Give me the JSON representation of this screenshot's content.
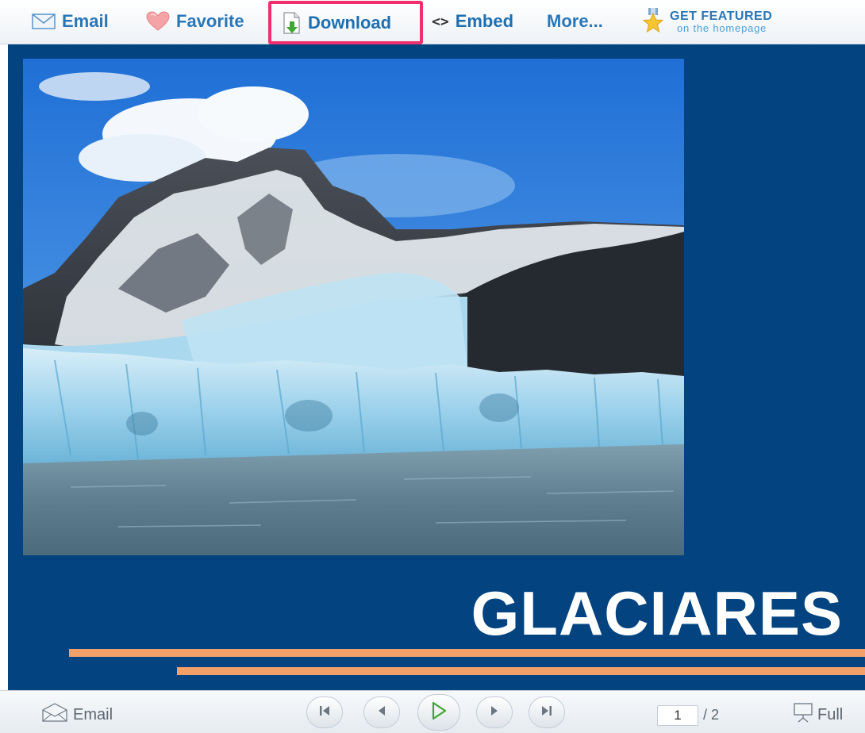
{
  "toolbar": {
    "email_label": "Email",
    "favorite_label": "Favorite",
    "download_label": "Download",
    "embed_glyph": "<>",
    "embed_label": "Embed",
    "more_label": "More...",
    "featured_title": "GET FEATURED",
    "featured_subtitle": "on the homepage",
    "highlight_color": "#f0306e",
    "link_color": "#2a77b8"
  },
  "slide": {
    "title": "GLACIARES",
    "background": "#024380",
    "stripe_color": "#f2a06a",
    "photo_subject": "glacier with snowy mountain peak, blue sky and lake"
  },
  "controls": {
    "email_label": "Email",
    "current_page": "1",
    "total_pages": "/ 2",
    "full_label": "Full",
    "buttons": [
      "first-slide",
      "previous-slide",
      "play",
      "next-slide",
      "last-slide"
    ]
  },
  "icons": {
    "toolbar": [
      "envelope-icon",
      "heart-icon",
      "download-icon",
      "star-badge-icon"
    ],
    "controls": [
      "envelope-open-icon",
      "skip-first-icon",
      "previous-icon",
      "play-icon",
      "next-icon",
      "skip-last-icon",
      "fullscreen-icon"
    ]
  }
}
